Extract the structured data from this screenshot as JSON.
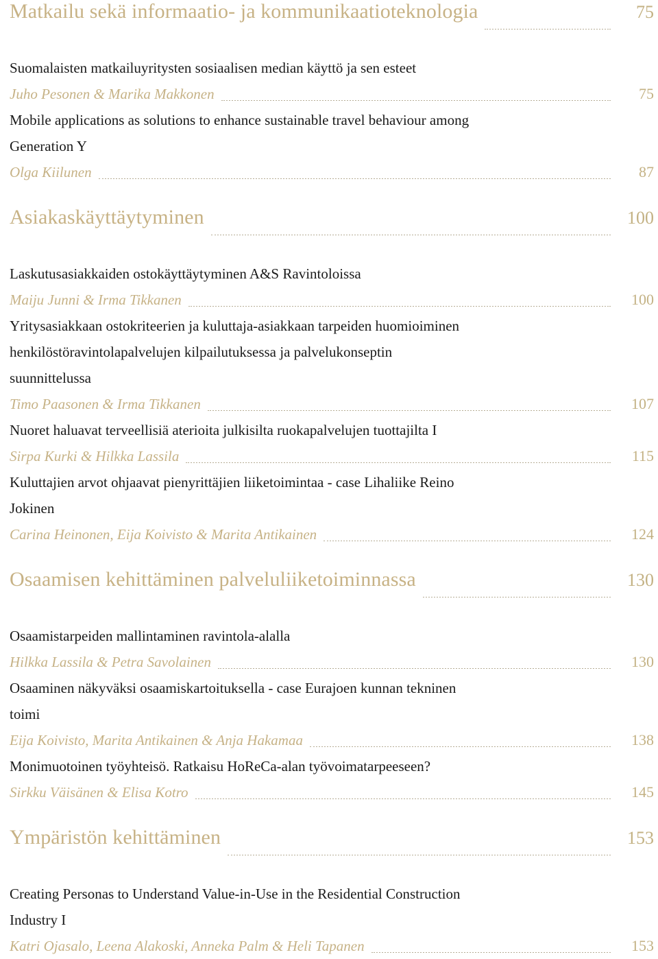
{
  "document": {
    "type": "table-of-contents",
    "language": "fi",
    "colors": {
      "heading_gold": "#c7b285",
      "author_gold": "#c6b286",
      "page_number_gold": "#c3b183",
      "body_text": "#1a1a1a",
      "leader_dots": "#b6ad95",
      "background": "#ffffff"
    }
  },
  "sections": [
    {
      "heading": "Matkailu sekä informaatio- ja kommunikaatioteknologia",
      "page": "75",
      "entries": [
        {
          "title_lines": [
            "Suomalaisten matkailuyritysten sosiaalisen median käyttö ja sen esteet"
          ],
          "authors": "Juho Pesonen & Marika Makkonen",
          "page": "75"
        },
        {
          "title_lines": [
            "Mobile applications as solutions to enhance sustainable travel behaviour among",
            "Generation Y"
          ],
          "authors": "Olga Kiilunen",
          "page": "87"
        }
      ]
    },
    {
      "heading": "Asiakaskäyttäytyminen",
      "page": "100",
      "entries": [
        {
          "title_lines": [
            "Laskutusasiakkaiden ostokäyttäytyminen A&S Ravintoloissa"
          ],
          "authors": "Maiju Junni & Irma Tikkanen",
          "page": "100"
        },
        {
          "title_lines": [
            "Yritysasiakkaan ostokriteerien ja kuluttaja-asiakkaan tarpeiden huomioiminen",
            "henkilöstöravintolapalvelujen kilpailutuksessa ja palvelukonseptin",
            "suunnittelussa"
          ],
          "authors": "Timo Paasonen & Irma Tikkanen",
          "page": "107"
        },
        {
          "title_lines": [
            "Nuoret haluavat terveellisiä aterioita julkisilta ruokapalvelujen tuottajilta I"
          ],
          "authors": "Sirpa Kurki & Hilkka Lassila",
          "page": "115"
        },
        {
          "title_lines": [
            "Kuluttajien arvot ohjaavat pienyrittäjien liiketoimintaa - case Lihaliike Reino",
            "Jokinen"
          ],
          "authors": "Carina Heinonen, Eija Koivisto & Marita Antikainen",
          "page": "124"
        }
      ]
    },
    {
      "heading": "Osaamisen kehittäminen palveluliiketoiminnassa",
      "page": "130",
      "entries": [
        {
          "title_lines": [
            "Osaamistarpeiden mallintaminen ravintola-alalla"
          ],
          "authors": "Hilkka Lassila & Petra Savolainen",
          "page": "130"
        },
        {
          "title_lines": [
            "Osaaminen näkyväksi osaamiskartoituksella - case Eurajoen kunnan tekninen",
            "toimi"
          ],
          "authors": "Eija Koivisto, Marita Antikainen & Anja Hakamaa",
          "page": "138"
        },
        {
          "title_lines": [
            "Monimuotoinen työyhteisö. Ratkaisu HoReCa-alan työvoimatarpeeseen?"
          ],
          "authors": "Sirkku Väisänen & Elisa Kotro",
          "page": "145"
        }
      ]
    },
    {
      "heading": "Ympäristön kehittäminen",
      "page": "153",
      "entries": [
        {
          "title_lines": [
            "Creating Personas to Understand Value-in-Use in the Residential Construction",
            "Industry I"
          ],
          "authors": "Katri Ojasalo, Leena Alakoski, Anneka Palm & Heli Tapanen",
          "page": "153"
        }
      ]
    }
  ]
}
